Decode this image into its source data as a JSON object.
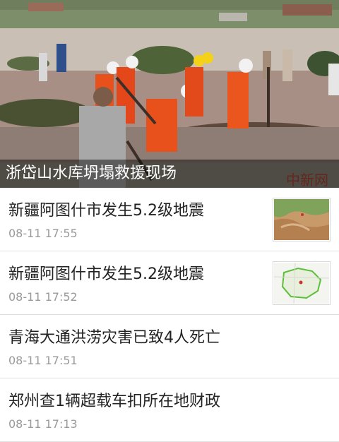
{
  "headline": {
    "caption": "浙岱山水库坍塌救援现场",
    "watermark": "中新网"
  },
  "news": [
    {
      "title": "新疆阿图什市发生5.2级地震",
      "time": "08-11 17:55",
      "thumbnail": "terrain-thumbnail"
    },
    {
      "title": "新疆阿图什市发生5.2级地震",
      "time": "08-11 17:52",
      "thumbnail": "map-thumbnail"
    },
    {
      "title": "青海大通洪涝灾害已致4人死亡",
      "time": "08-11 17:51"
    },
    {
      "title": "郑州查1辆超载车扣所在地财政",
      "time": "08-11 17:13"
    }
  ],
  "colors": {
    "caption_bg": "#000000",
    "title_text": "#222222",
    "time_text": "#9a9a9a",
    "divider": "#e0e0e0",
    "rescue_orange": "#e8501c"
  }
}
